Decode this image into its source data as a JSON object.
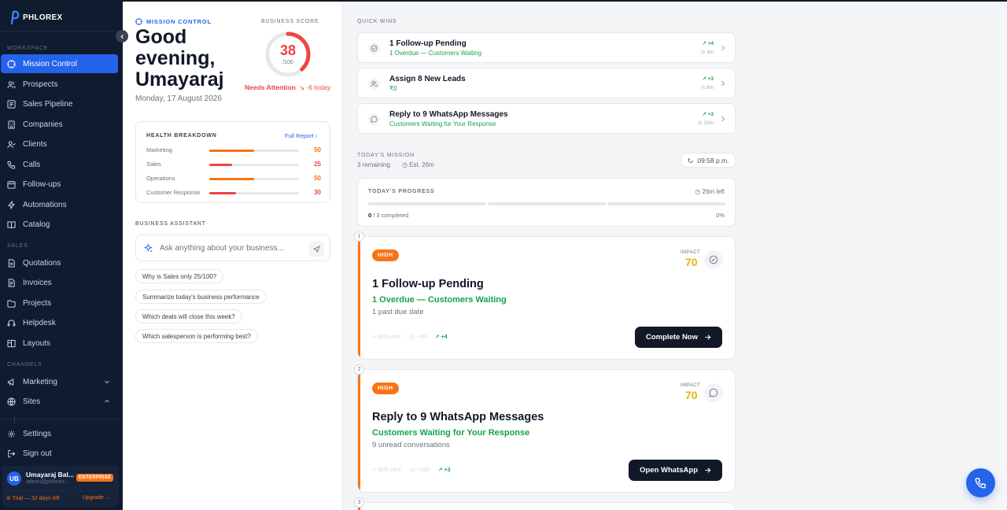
{
  "brand": {
    "name": "PHLOREX"
  },
  "sidebar": {
    "sections": {
      "workspace": "WORKSPACE",
      "sales": "SALES",
      "channels": "CHANNELS"
    },
    "workspace_items": [
      {
        "label": "Mission Control",
        "icon": "target-icon",
        "active": true
      },
      {
        "label": "Prospects",
        "icon": "users-icon"
      },
      {
        "label": "Sales Pipeline",
        "icon": "pipeline-icon"
      },
      {
        "label": "Companies",
        "icon": "building-icon"
      },
      {
        "label": "Clients",
        "icon": "user-check-icon"
      },
      {
        "label": "Calls",
        "icon": "phone-icon"
      },
      {
        "label": "Follow-ups",
        "icon": "calendar-icon"
      },
      {
        "label": "Automations",
        "icon": "bolt-icon"
      },
      {
        "label": "Catalog",
        "icon": "book-icon"
      }
    ],
    "sales_items": [
      {
        "label": "Quotations",
        "icon": "doc-icon"
      },
      {
        "label": "Invoices",
        "icon": "receipt-icon"
      },
      {
        "label": "Projects",
        "icon": "folder-icon"
      },
      {
        "label": "Helpdesk",
        "icon": "headset-icon"
      },
      {
        "label": "Layouts",
        "icon": "layout-icon"
      }
    ],
    "channel_items": [
      {
        "label": "Marketing",
        "icon": "megaphone-icon",
        "chevron": "down"
      },
      {
        "label": "Sites",
        "icon": "globe-icon",
        "chevron": "up"
      }
    ],
    "bottom_items": [
      {
        "label": "Settings",
        "icon": "gear-icon"
      },
      {
        "label": "Sign out",
        "icon": "logout-icon"
      }
    ],
    "user": {
      "initials": "UB",
      "name": "Umayaraj Bal...",
      "email": "admin@phlorex...",
      "plan": "ENTERPRISE",
      "trial": "⊘ Trial — 32 days left",
      "upgrade": "Upgrade →"
    }
  },
  "left": {
    "section_label": "MISSION CONTROL",
    "greeting": "Good evening, Umayaraj",
    "date": "Monday, 17 August 2026",
    "score": {
      "label": "BUSINESS SCORE",
      "value": 38,
      "value_text": "38",
      "max_text": "/100",
      "status": "Needs Attention",
      "delta": "↘ -6 today",
      "color": "#ef4444"
    },
    "health": {
      "title": "HEALTH BREAKDOWN",
      "link": "Full Report ›",
      "rows": [
        {
          "label": "Marketing",
          "value": 50,
          "value_text": "50",
          "color": "#f97316"
        },
        {
          "label": "Sales",
          "value": 25,
          "value_text": "25",
          "color": "#ef4444"
        },
        {
          "label": "Operations",
          "value": 50,
          "value_text": "50",
          "color": "#f97316"
        },
        {
          "label": "Customer Response",
          "value": 30,
          "value_text": "30",
          "color": "#ef4444"
        }
      ]
    },
    "assistant": {
      "label": "BUSINESS ASSISTANT",
      "placeholder": "Ask anything about your business...",
      "chips": [
        "Why is Sales only 25/100?",
        "Summarize today's business performance",
        "Which deals will close this week?",
        "Which salesperson is performing best?"
      ]
    }
  },
  "quick_wins": {
    "label": "QUICK WINS",
    "items": [
      {
        "title": "1 Follow-up Pending",
        "sub": "1 Overdue — Customers Waiting",
        "pts": "↗ +4",
        "time": "◷ 3m",
        "icon": "check-circle-icon"
      },
      {
        "title": "Assign 8 New Leads",
        "sub": "₹0",
        "pts": "↗ +3",
        "time": "◷ 8m",
        "icon": "users-icon"
      },
      {
        "title": "Reply to 9 WhatsApp Messages",
        "sub": "Customers Waiting for Your Response",
        "pts": "↗ +3",
        "time": "◷ 15m",
        "icon": "chat-icon"
      }
    ]
  },
  "mission": {
    "label": "TODAY'S MISSION",
    "remaining": "3 remaining",
    "est": "◷ Est. 26m",
    "clock": "09:58 p.m.",
    "progress": {
      "title": "TODAY'S PROGRESS",
      "time_left": "◷ 26m left",
      "completed": "0",
      "total": " / 3 completed",
      "pct": "0%",
      "fraction": 0
    },
    "tasks": [
      {
        "step": "1",
        "priority": "HIGH",
        "impact_label": "IMPACT",
        "impact": "70",
        "title": "1 Follow-up Pending",
        "sub": "1 Overdue — Customers Waiting",
        "desc": "1 past due date",
        "conf": "⚡ 80% conf.",
        "time": "◷ ~3m",
        "pts": "↗ +4",
        "button": "Complete Now",
        "icon": "check-circle-icon"
      },
      {
        "step": "2",
        "priority": "HIGH",
        "impact_label": "IMPACT",
        "impact": "70",
        "title": "Reply to 9 WhatsApp Messages",
        "sub": "Customers Waiting for Your Response",
        "desc": "9 unread conversations",
        "conf": "⚡ 90% conf.",
        "time": "◷ ~15m",
        "pts": "↗ +3",
        "button": "Open WhatsApp",
        "icon": "chat-icon"
      }
    ],
    "next_step": "3"
  }
}
